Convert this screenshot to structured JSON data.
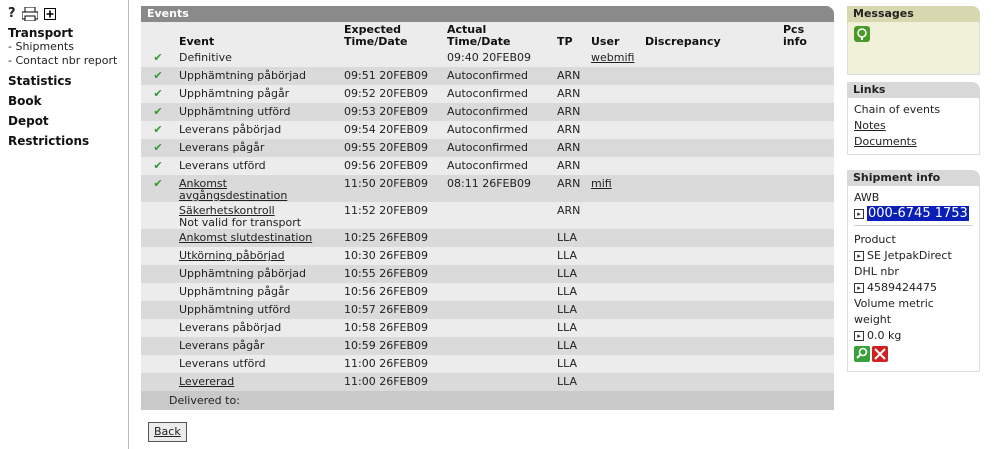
{
  "nav": {
    "help": "?",
    "transport": "Transport",
    "shipments": "- Shipments",
    "contact": "- Contact nbr report",
    "statistics": "Statistics",
    "book": "Book",
    "depot": "Depot",
    "restrictions": "Restrictions"
  },
  "events": {
    "title": "Events",
    "columns": {
      "event": "Event",
      "expected": "Expected Time/Date",
      "actual": "Actual Time/Date",
      "tp": "TP",
      "user": "User",
      "discrepancy": "Discrepancy",
      "pcs": "Pcs info"
    },
    "rows": [
      {
        "check": "✔",
        "event": "Definitive",
        "link": false,
        "event2": "",
        "expected": "",
        "actual": "09:40 20FEB09",
        "tp": "",
        "user": "webmifi"
      },
      {
        "check": "✔",
        "event": "Upphämtning påbörjad",
        "link": false,
        "event2": "",
        "expected": "09:51 20FEB09",
        "actual": "Autoconfirmed",
        "tp": "ARN",
        "user": ""
      },
      {
        "check": "✔",
        "event": "Upphämtning pågår",
        "link": false,
        "event2": "",
        "expected": "09:52 20FEB09",
        "actual": "Autoconfirmed",
        "tp": "ARN",
        "user": ""
      },
      {
        "check": "✔",
        "event": "Upphämtning utförd",
        "link": false,
        "event2": "",
        "expected": "09:53 20FEB09",
        "actual": "Autoconfirmed",
        "tp": "ARN",
        "user": ""
      },
      {
        "check": "✔",
        "event": "Leverans påbörjad",
        "link": false,
        "event2": "",
        "expected": "09:54 20FEB09",
        "actual": "Autoconfirmed",
        "tp": "ARN",
        "user": ""
      },
      {
        "check": "✔",
        "event": "Leverans pågår",
        "link": false,
        "event2": "",
        "expected": "09:55 20FEB09",
        "actual": "Autoconfirmed",
        "tp": "ARN",
        "user": ""
      },
      {
        "check": "✔",
        "event": "Leverans utförd",
        "link": false,
        "event2": "",
        "expected": "09:56 20FEB09",
        "actual": "Autoconfirmed",
        "tp": "ARN",
        "user": ""
      },
      {
        "check": "✔",
        "event": "Ankomst avgångsdestination",
        "link": true,
        "event2": "",
        "expected": "11:50 20FEB09",
        "actual": "08:11 26FEB09",
        "tp": "ARN",
        "user": "mifi"
      },
      {
        "check": "",
        "event": "Säkerhetskontroll",
        "link": true,
        "event2": "Not valid for transport",
        "expected": "11:52 20FEB09",
        "actual": "",
        "tp": "ARN",
        "user": ""
      },
      {
        "check": "",
        "event": "Ankomst slutdestination",
        "link": true,
        "event2": "",
        "expected": "10:25 26FEB09",
        "actual": "",
        "tp": "LLA",
        "user": ""
      },
      {
        "check": "",
        "event": "Utkörning påbörjad",
        "link": true,
        "event2": "",
        "expected": "10:30 26FEB09",
        "actual": "",
        "tp": "LLA",
        "user": ""
      },
      {
        "check": "",
        "event": "Upphämtning påbörjad",
        "link": false,
        "event2": "",
        "expected": "10:55 26FEB09",
        "actual": "",
        "tp": "LLA",
        "user": ""
      },
      {
        "check": "",
        "event": "Upphämtning pågår",
        "link": false,
        "event2": "",
        "expected": "10:56 26FEB09",
        "actual": "",
        "tp": "LLA",
        "user": ""
      },
      {
        "check": "",
        "event": "Upphämtning utförd",
        "link": false,
        "event2": "",
        "expected": "10:57 26FEB09",
        "actual": "",
        "tp": "LLA",
        "user": ""
      },
      {
        "check": "",
        "event": "Leverans påbörjad",
        "link": false,
        "event2": "",
        "expected": "10:58 26FEB09",
        "actual": "",
        "tp": "LLA",
        "user": ""
      },
      {
        "check": "",
        "event": "Leverans pågår",
        "link": false,
        "event2": "",
        "expected": "10:59 26FEB09",
        "actual": "",
        "tp": "LLA",
        "user": ""
      },
      {
        "check": "",
        "event": "Leverans utförd",
        "link": false,
        "event2": "",
        "expected": "11:00 26FEB09",
        "actual": "",
        "tp": "LLA",
        "user": ""
      },
      {
        "check": "",
        "event": "Levererad",
        "link": true,
        "event2": "",
        "expected": "11:00 26FEB09",
        "actual": "",
        "tp": "LLA",
        "user": ""
      }
    ],
    "delivered_to": "Delivered to:",
    "back": "Back"
  },
  "messages": {
    "title": "Messages",
    "icon": "message-icon"
  },
  "links": {
    "title": "Links",
    "chain": "Chain of events",
    "notes": "Notes",
    "documents": "Documents"
  },
  "shipment": {
    "title": "Shipment info",
    "awb_label": "AWB",
    "awb": "000-6745 1753",
    "product_label": "Product",
    "product": "SE JetpakDirect",
    "dhl_label": "DHL nbr",
    "dhl": "4589424475",
    "volume_label": "Volume metric weight",
    "volume": "0.0 kg"
  },
  "colors": {
    "accent": "#0a1fb8",
    "check": "#2f9a2f",
    "header": "#8a8a8a"
  }
}
